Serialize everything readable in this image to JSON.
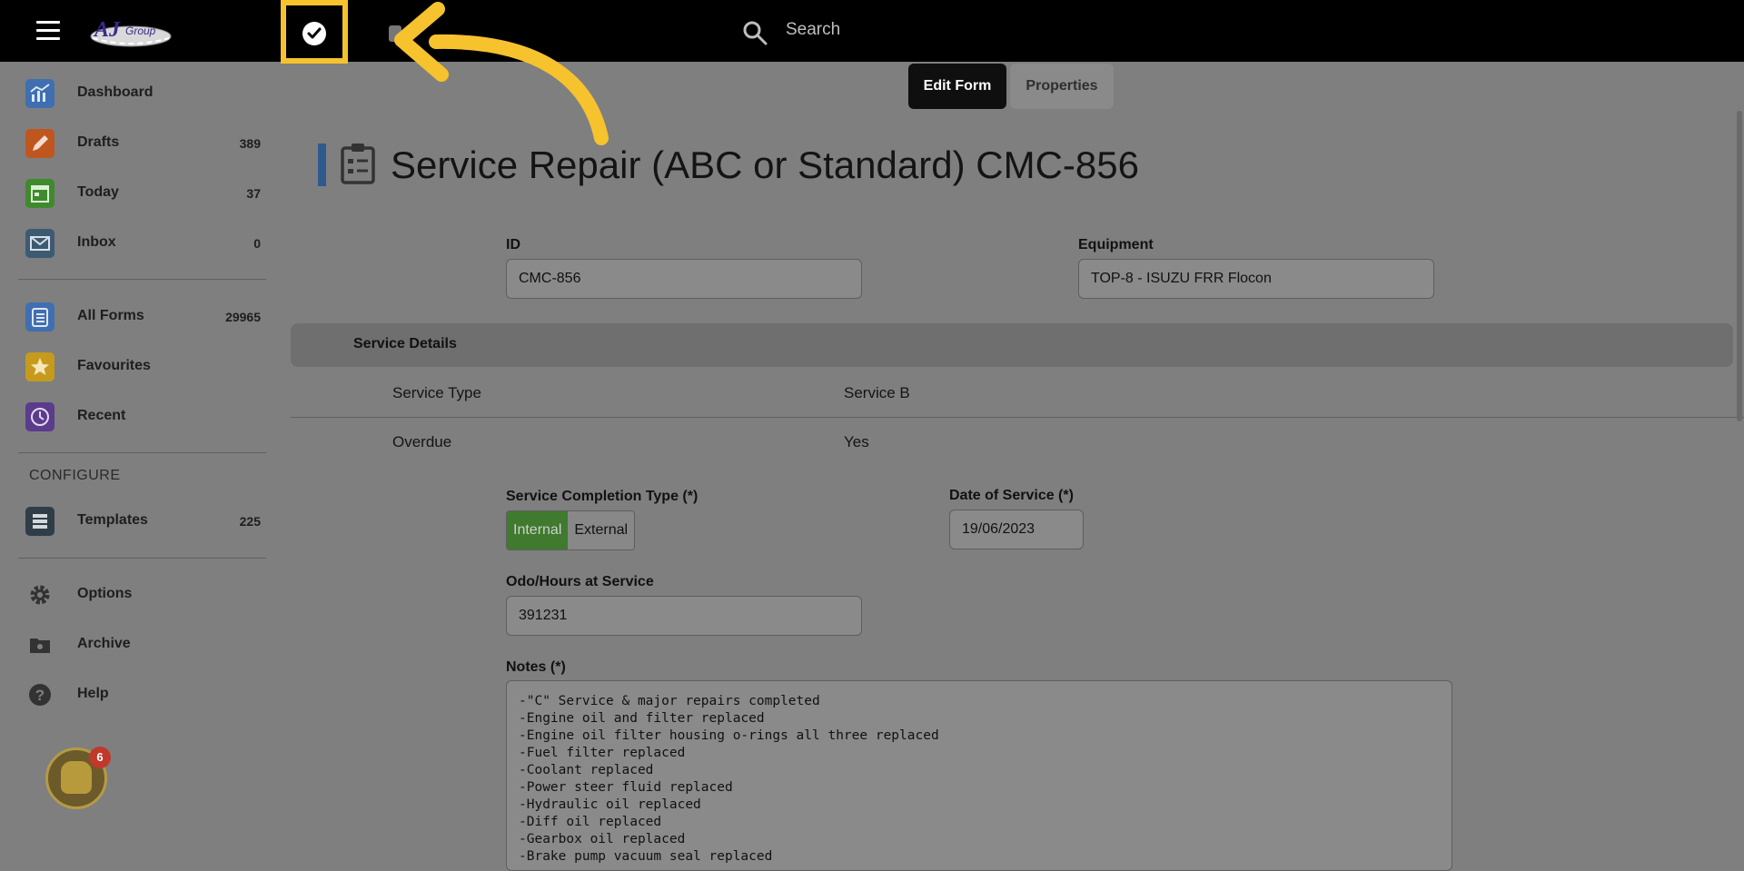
{
  "header": {
    "search_placeholder": "Search",
    "logo_text": "AJ Group",
    "accent_color": "#f6c22e"
  },
  "sidebar": {
    "items": [
      {
        "label": "Dashboard",
        "count": "",
        "icon": "chart-icon",
        "color": "#3f6fb0"
      },
      {
        "label": "Drafts",
        "count": "389",
        "icon": "pencil-icon",
        "color": "#c0561f"
      },
      {
        "label": "Today",
        "count": "37",
        "icon": "calendar-icon",
        "color": "#3f8a2c"
      },
      {
        "label": "Inbox",
        "count": "0",
        "icon": "mail-icon",
        "color": "#3d5a73"
      },
      {
        "label": "All Forms",
        "count": "29965",
        "icon": "clipboard-icon",
        "color": "#3f6fb0"
      },
      {
        "label": "Favourites",
        "count": "",
        "icon": "star-icon",
        "color": "#c69a1c"
      },
      {
        "label": "Recent",
        "count": "",
        "icon": "clock-icon",
        "color": "#5b3b8c"
      },
      {
        "label": "Templates",
        "count": "225",
        "icon": "list-icon",
        "color": "#2f3d48"
      },
      {
        "label": "Options",
        "count": "",
        "icon": "gear-icon",
        "color": "#333333"
      },
      {
        "label": "Archive",
        "count": "",
        "icon": "folder-icon",
        "color": "#333333"
      },
      {
        "label": "Help",
        "count": "",
        "icon": "help-icon",
        "color": "#333333"
      }
    ],
    "configure_label": "CONFIGURE",
    "notification_count": "6"
  },
  "tabs": {
    "edit_form": "Edit Form",
    "properties": "Properties"
  },
  "form": {
    "title": "Service Repair (ABC or Standard) CMC-856",
    "id_label": "ID",
    "id_value": "CMC-856",
    "equipment_label": "Equipment",
    "equipment_value": "TOP-8 - ISUZU FRR Flocon",
    "section_title": "Service Details",
    "service_type_key": "Service Type",
    "service_type_value": "Service B",
    "overdue_key": "Overdue",
    "overdue_value": "Yes",
    "completion_label": "Service Completion Type (*)",
    "completion_options": [
      "Internal",
      "External"
    ],
    "completion_selected": "Internal",
    "date_label": "Date of Service (*)",
    "date_value": "19/06/2023",
    "odo_label": "Odo/Hours at Service",
    "odo_value": "391231",
    "notes_label": "Notes (*)",
    "notes_lines": [
      "-\"C\" Service & major repairs completed",
      "-Engine oil and filter replaced",
      "-Engine oil filter housing o-rings all three replaced",
      "-Fuel filter replaced",
      "-Coolant replaced",
      "-Power steer fluid replaced",
      "-Hydraulic oil replaced",
      "-Diff oil replaced",
      "-Gearbox oil replaced",
      "-Brake pump vacuum seal replaced"
    ]
  }
}
